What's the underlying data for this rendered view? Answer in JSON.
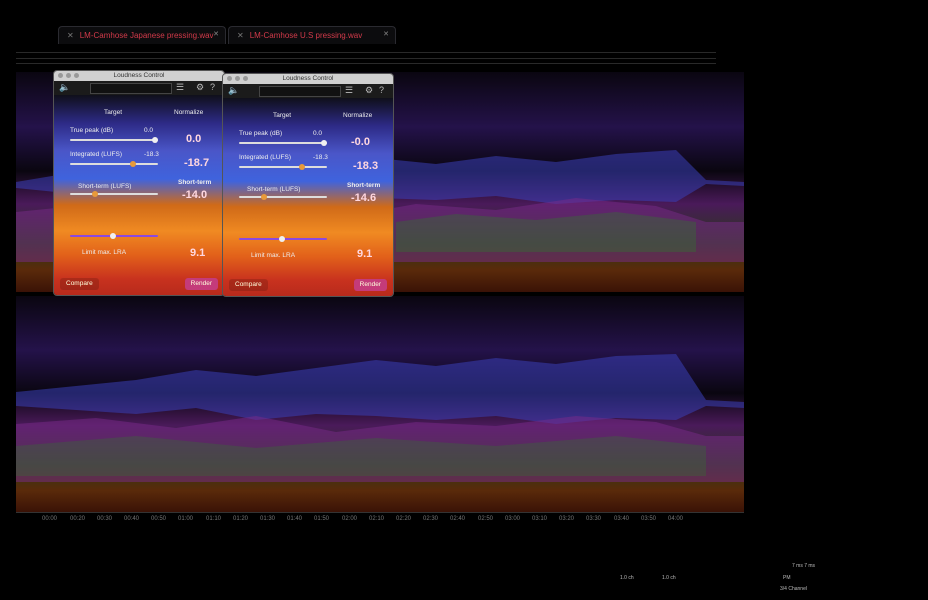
{
  "tabs": [
    {
      "label": "LM-Camhose Japanese pressing.wav"
    },
    {
      "label": "LM-Camhose U.S pressing.wav"
    }
  ],
  "panels": [
    {
      "title": "Loudness Control",
      "target": "Target",
      "normalize": "Normalize",
      "true_peak_label": "True peak (dB)",
      "true_peak_value": "0.0",
      "true_peak_big": "0.0",
      "integrated_label": "Integrated (LUFS)",
      "integrated_value": "-18.3",
      "integrated_big": "-18.7",
      "short_term_label": "Short-term (LUFS)",
      "short_term_title": "Short-term",
      "short_term_big": "-14.0",
      "lra_big": "9.1",
      "max_lra_label": "Limit max. LRA",
      "compare": "Compare",
      "render": "Render"
    },
    {
      "title": "Loudness Control",
      "target": "Target",
      "normalize": "Normalize",
      "true_peak_label": "True peak (dB)",
      "true_peak_value": "0.0",
      "true_peak_big": "-0.0",
      "integrated_label": "Integrated (LUFS)",
      "integrated_value": "-18.3",
      "integrated_big": "-18.3",
      "short_term_label": "Short-term (LUFS)",
      "short_term_title": "Short-term",
      "short_term_big": "-14.6",
      "lra_big": "9.1",
      "max_lra_label": "Limit max. LRA",
      "compare": "Compare",
      "render": "Render"
    }
  ],
  "timeline": [
    "00:00",
    "00:20",
    "00:30",
    "00:40",
    "00:50",
    "01:00",
    "01:10",
    "01:20",
    "01:30",
    "01:40",
    "01:50",
    "02:00",
    "02:10",
    "02:20",
    "02:30",
    "02:40",
    "02:50",
    "03:00",
    "03:10",
    "03:20",
    "03:30",
    "03:40",
    "03:50",
    "04:00"
  ],
  "status": {
    "left_a": "1.0 ch",
    "left_b": "1.0 ch",
    "right_a": "7 ms  7 ms",
    "right_b": "PM",
    "right_c": "3/4 Channel"
  },
  "colors": {
    "accent": "#d23a4a",
    "render": "#c43b7a"
  }
}
